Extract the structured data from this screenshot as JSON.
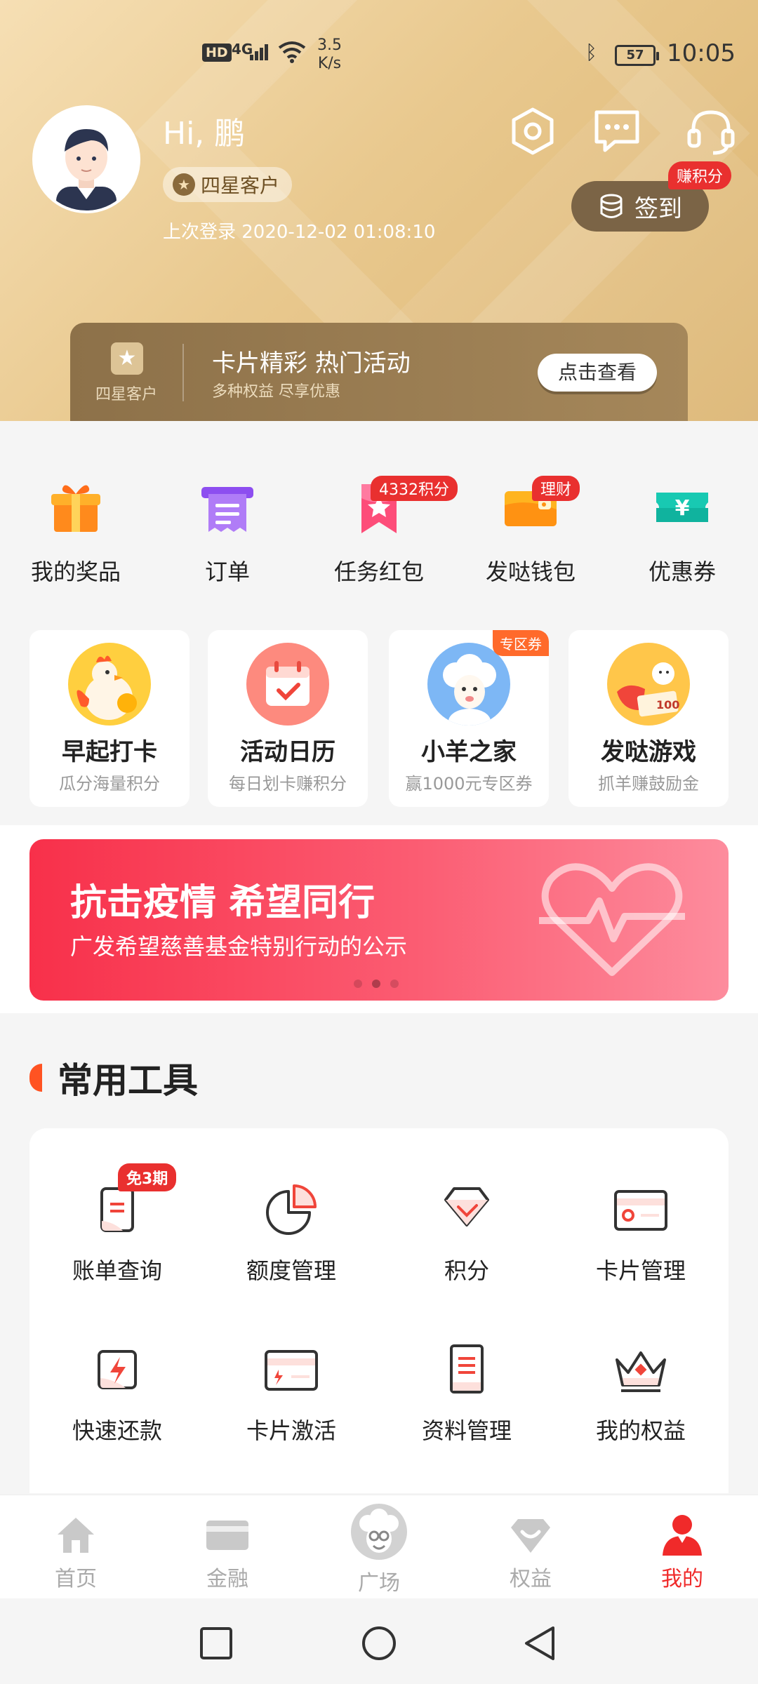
{
  "status_bar": {
    "hd": "HD",
    "network": "4G",
    "speed_value": "3.5",
    "speed_unit": "K/s",
    "battery": "57",
    "time": "10:05"
  },
  "profile": {
    "greeting": "Hi, 鹏",
    "tier": "四星客户",
    "last_login": "上次登录 2020-12-02 01:08:10",
    "checkin_label": "签到",
    "earn_points_tag": "赚积分"
  },
  "promo": {
    "tier_label": "四星客户",
    "title": "卡片精彩 热门活动",
    "subtitle": "多种权益 尽享优惠",
    "button": "点击查看"
  },
  "quick_entries": [
    {
      "label": "我的奖品",
      "icon": "gift-icon"
    },
    {
      "label": "订单",
      "icon": "receipt-icon"
    },
    {
      "label": "任务红包",
      "icon": "red-packet-icon",
      "badge": "4332积分"
    },
    {
      "label": "发哒钱包",
      "icon": "wallet-icon",
      "badge": "理财"
    },
    {
      "label": "优惠券",
      "icon": "coupon-icon"
    }
  ],
  "activities": [
    {
      "name": "早起打卡",
      "desc": "瓜分海量积分"
    },
    {
      "name": "活动日历",
      "desc": "每日划卡赚积分"
    },
    {
      "name": "小羊之家",
      "desc": "赢1000元专区券",
      "corner": "专区券"
    },
    {
      "name": "发哒游戏",
      "desc": "抓羊赚鼓励金"
    }
  ],
  "banner": {
    "title": "抗击疫情 希望同行",
    "subtitle": "广发希望慈善基金特别行动的公示",
    "page_count": 3,
    "active_page": 2
  },
  "tools_section": {
    "title": "常用工具",
    "items": [
      {
        "label": "账单查询",
        "icon": "bill-icon",
        "badge": "免3期"
      },
      {
        "label": "额度管理",
        "icon": "pie-chart-icon"
      },
      {
        "label": "积分",
        "icon": "diamond-icon"
      },
      {
        "label": "卡片管理",
        "icon": "card-settings-icon"
      },
      {
        "label": "快速还款",
        "icon": "lightning-icon"
      },
      {
        "label": "卡片激活",
        "icon": "card-activate-icon"
      },
      {
        "label": "资料管理",
        "icon": "document-icon"
      },
      {
        "label": "我的权益",
        "icon": "crown-icon"
      }
    ]
  },
  "tabbar": [
    {
      "label": "首页",
      "icon": "home-icon"
    },
    {
      "label": "金融",
      "icon": "card-icon"
    },
    {
      "label": "广场",
      "icon": "mascot-icon"
    },
    {
      "label": "权益",
      "icon": "rights-icon"
    },
    {
      "label": "我的",
      "icon": "user-icon",
      "active": true
    }
  ],
  "colors": {
    "accent_red": "#f02a2a",
    "header_gold": "#e9c98f",
    "tag_red": "#e9302f"
  }
}
